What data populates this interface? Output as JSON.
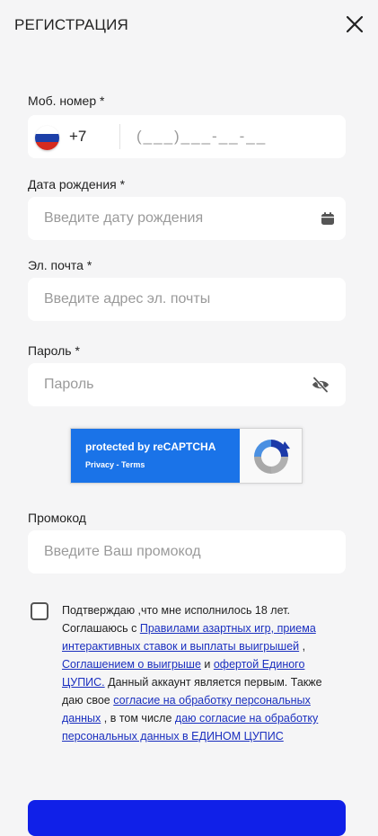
{
  "header": {
    "title": "РЕГИСТРАЦИЯ"
  },
  "phone": {
    "label": "Моб. номер *",
    "country_code": "+7",
    "mask_placeholder": "(___)___-__-__"
  },
  "birthdate": {
    "label": "Дата рождения *",
    "placeholder": "Введите дату рождения"
  },
  "email": {
    "label": "Эл. почта *",
    "placeholder": "Введите адрес эл. почты"
  },
  "password": {
    "label": "Пароль *",
    "placeholder": "Пароль"
  },
  "recaptcha": {
    "protected_text": "protected by reCAPTCHA",
    "privacy": "Privacy",
    "separator": " - ",
    "terms": "Terms"
  },
  "promo": {
    "label": "Промокод",
    "placeholder": "Введите Ваш промокод"
  },
  "consent": {
    "t1": "Подтверждаю ,что мне исполнилось 18 лет. Соглашаюсь с ",
    "link1": "Правилами азартных игр, приема интерактивных ставок и выплаты выигрышей",
    "t2": " , ",
    "link2": "Соглашением о выигрыше",
    "t3": "  и ",
    "link3": "офертой Единого ЦУПИС.",
    "t4": " Данный аккаунт является первым. Также даю свое ",
    "link4": "согласие на обработку персональных данных",
    "t5": " , в том числе ",
    "link5": "даю согласие на обработку персональных данных в ЕДИНОМ  ЦУПИС"
  },
  "colors": {
    "background": "#f5f5f6",
    "field": "#ffffff",
    "link": "#1a2fbf",
    "recaptcha_blue": "#1a73e8",
    "submit": "#1020e8"
  },
  "icons": [
    "close-icon",
    "russia-flag-icon",
    "calendar-icon",
    "eye-slash-icon",
    "recaptcha-logo-icon"
  ]
}
